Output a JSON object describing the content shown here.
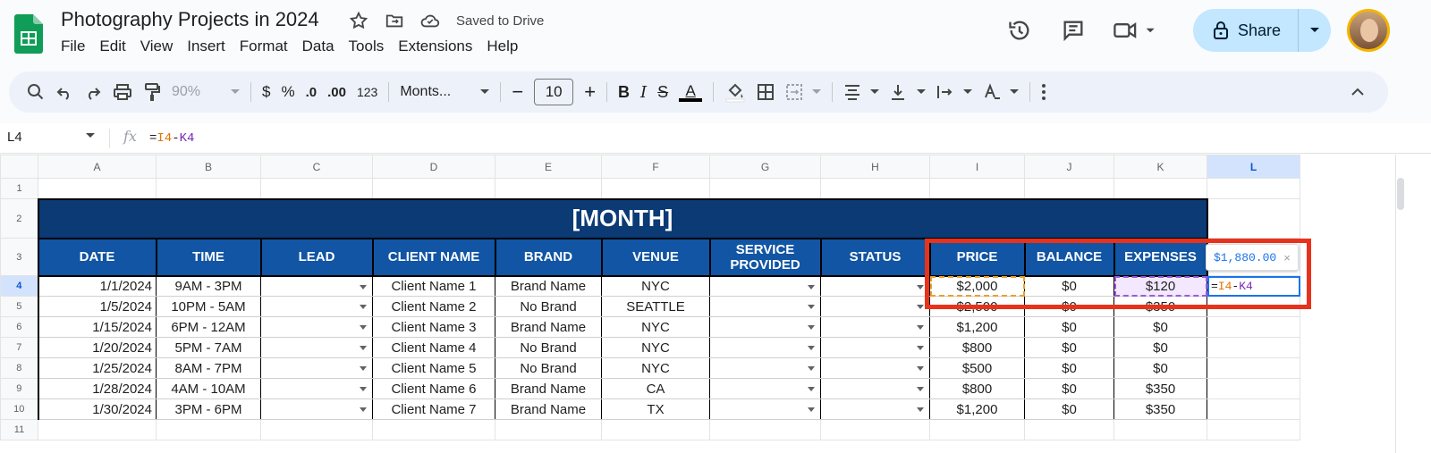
{
  "app": {
    "title": "Photography Projects in 2024",
    "saved_status": "Saved to Drive",
    "menu": [
      "File",
      "Edit",
      "View",
      "Insert",
      "Format",
      "Data",
      "Tools",
      "Extensions",
      "Help"
    ],
    "share_label": "Share"
  },
  "toolbar": {
    "zoom": "90%",
    "currency": "$",
    "percent": "%",
    "dec_decrease": ".0",
    "dec_increase": ".00",
    "number_format": "123",
    "font": "Monts...",
    "font_size": "10",
    "minus": "−",
    "plus": "+",
    "bold": "B",
    "italic": "I",
    "strike": "S",
    "text_color": "A"
  },
  "formula_bar": {
    "cell_ref": "L4",
    "fx": "fx",
    "eq": "=",
    "ref1": "I4",
    "op": "-",
    "ref2": "K4"
  },
  "columns": [
    "A",
    "B",
    "C",
    "D",
    "E",
    "F",
    "G",
    "H",
    "I",
    "J",
    "K",
    "L"
  ],
  "rows": [
    "1",
    "2",
    "3",
    "4",
    "5",
    "6",
    "7",
    "8",
    "9",
    "10",
    "11"
  ],
  "sheet": {
    "month_title": "[MONTH]",
    "headers": [
      "DATE",
      "TIME",
      "LEAD",
      "CLIENT NAME",
      "BRAND",
      "VENUE",
      "SERVICE PROVIDED",
      "STATUS",
      "PRICE",
      "BALANCE",
      "EXPENSES"
    ],
    "records": [
      {
        "date": "1/1/2024",
        "time": "9AM - 3PM",
        "client": "Client Name 1",
        "brand": "Brand Name",
        "venue": "NYC",
        "price": "$2,000",
        "balance": "$0",
        "expenses": "$120"
      },
      {
        "date": "1/5/2024",
        "time": "10PM - 5AM",
        "client": "Client Name 2",
        "brand": "No Brand",
        "venue": "SEATTLE",
        "price": "$2,500",
        "balance": "$0",
        "expenses": "$350"
      },
      {
        "date": "1/15/2024",
        "time": "6PM - 12AM",
        "client": "Client Name 3",
        "brand": "Brand Name",
        "venue": "NYC",
        "price": "$1,200",
        "balance": "$0",
        "expenses": "$0"
      },
      {
        "date": "1/20/2024",
        "time": "5PM - 7AM",
        "client": "Client Name 4",
        "brand": "No Brand",
        "venue": "NYC",
        "price": "$800",
        "balance": "$0",
        "expenses": "$0"
      },
      {
        "date": "1/25/2024",
        "time": "8AM - 7PM",
        "client": "Client Name 5",
        "brand": "No Brand",
        "venue": "NYC",
        "price": "$500",
        "balance": "$0",
        "expenses": "$0"
      },
      {
        "date": "1/28/2024",
        "time": "4AM - 10AM",
        "client": "Client Name 6",
        "brand": "Brand Name",
        "venue": "CA",
        "price": "$800",
        "balance": "$0",
        "expenses": "$350"
      },
      {
        "date": "1/30/2024",
        "time": "3PM - 6PM",
        "client": "Client Name 7",
        "brand": "Brand Name",
        "venue": "TX",
        "price": "$1,200",
        "balance": "$0",
        "expenses": "$350"
      }
    ],
    "active_cell_eq": "=",
    "active_cell_ref1": "I4",
    "active_cell_op": "-",
    "active_cell_ref2": "K4",
    "tooltip_value": "$1,880.00",
    "tooltip_close": "×"
  },
  "colors": {
    "month_bg": "#0b3a75",
    "header_bg": "#1155a4",
    "highlight_box": "#e8321c",
    "share_bg": "#c2e7ff"
  }
}
